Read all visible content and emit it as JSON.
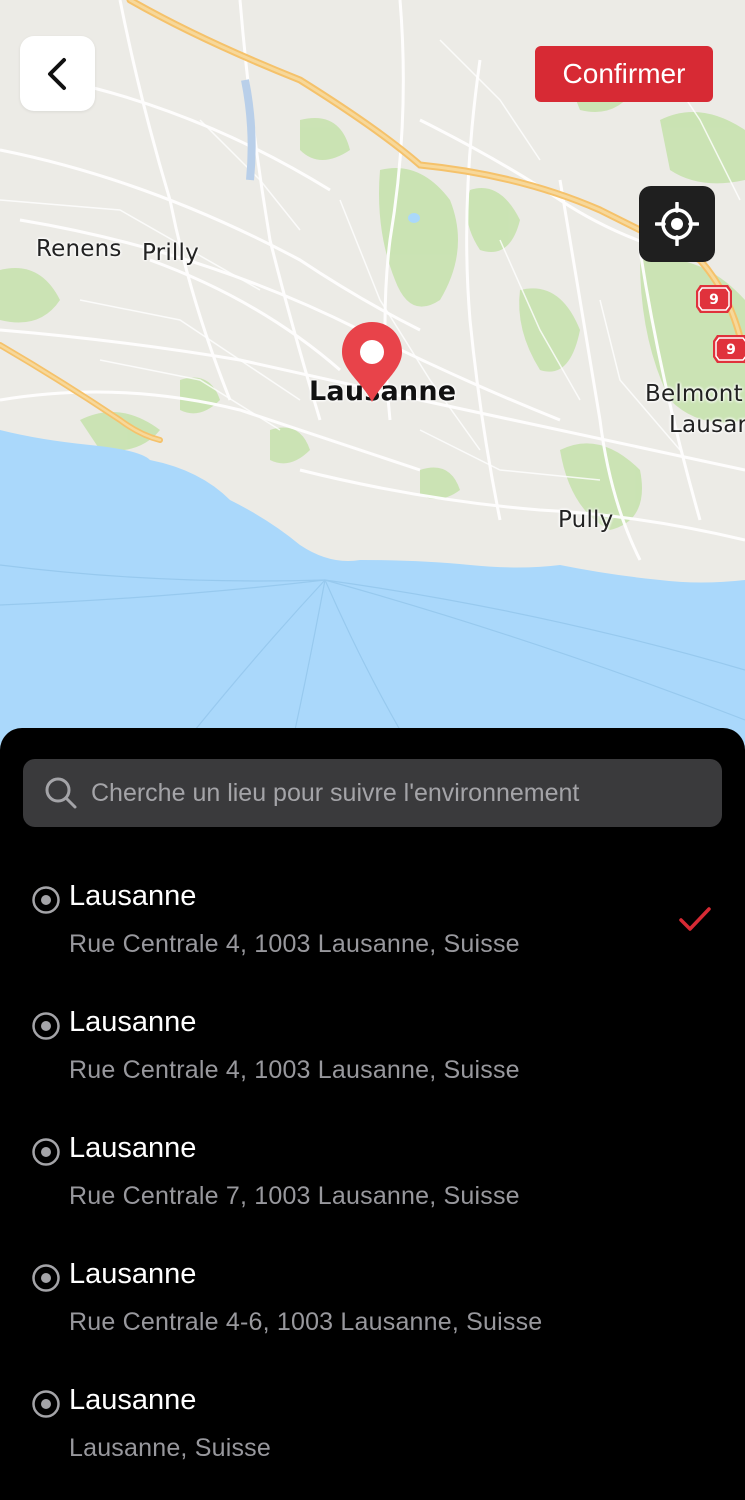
{
  "header": {
    "confirm_label": "Confirmer"
  },
  "icons": {
    "back": "chevron-left-icon",
    "locate": "crosshair-icon",
    "search": "search-icon",
    "result": "location-dot-icon",
    "selected": "checkmark-icon"
  },
  "colors": {
    "accent": "#d72a34",
    "sheet_background": "#000000",
    "search_field": "#3a3a3c",
    "water": "#aad8fb"
  },
  "map": {
    "labels": {
      "renens": "Renens",
      "prilly": "Prilly",
      "lausanne": "Lausanne",
      "belmont_1": "Belmont",
      "belmont_2": "Lausar",
      "pully": "Pully"
    },
    "highway_shields": [
      "9",
      "9"
    ]
  },
  "search": {
    "placeholder": "Cherche un lieu pour suivre l'environnement",
    "value": ""
  },
  "results": [
    {
      "title": "Lausanne",
      "address": "Rue Centrale 4, 1003 Lausanne, Suisse",
      "selected": true
    },
    {
      "title": "Lausanne",
      "address": "Rue Centrale 4, 1003 Lausanne, Suisse",
      "selected": false
    },
    {
      "title": "Lausanne",
      "address": "Rue Centrale 7, 1003 Lausanne, Suisse",
      "selected": false
    },
    {
      "title": "Lausanne",
      "address": "Rue Centrale 4-6, 1003 Lausanne, Suisse",
      "selected": false
    },
    {
      "title": "Lausanne",
      "address": "Lausanne, Suisse",
      "selected": false
    }
  ]
}
